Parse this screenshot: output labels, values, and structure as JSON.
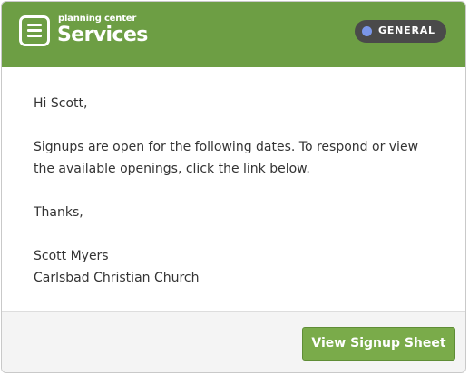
{
  "header": {
    "brand_small": "planning center",
    "brand_name": "Services",
    "badge_label": "GENERAL",
    "badge_dot_color": "#7a96e8",
    "background_color": "#6d9e44"
  },
  "message": {
    "greeting": "Hi Scott,",
    "body": "Signups are open for the following dates. To respond or view the available openings, click the link below.",
    "closing": "Thanks,",
    "signature_name": "Scott Myers",
    "signature_org": "Carlsbad Christian Church"
  },
  "footer": {
    "cta_label": "View Signup Sheet",
    "cta_color": "#7aab4a"
  }
}
